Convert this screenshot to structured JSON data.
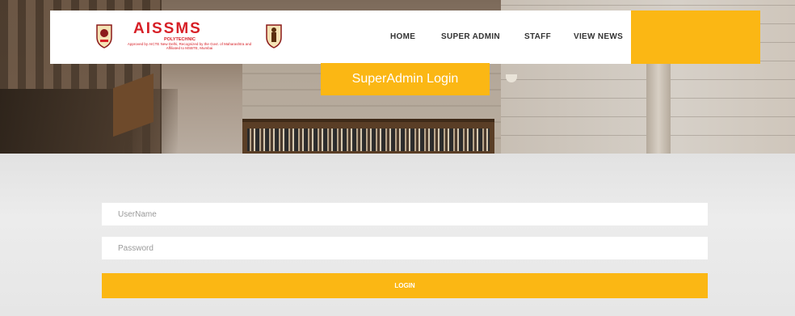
{
  "brand": {
    "name": "AISSMS",
    "subtitle": "POLYTECHNIC",
    "note": "Approved by AICTE New Delhi, Recognized by the Govt. of Maharashtra and Affiliated to MSBTE, Mumbai",
    "emblem_icon": "college-crest-icon"
  },
  "nav": {
    "items": [
      "HOME",
      "SUPER ADMIN",
      "STAFF",
      "VIEW NEWS"
    ]
  },
  "login": {
    "title": "SuperAdmin Login",
    "username_placeholder": "UserName",
    "password_placeholder": "Password",
    "username_value": "",
    "password_value": "",
    "button_label": "LOGIN"
  },
  "colors": {
    "accent": "#fbb714",
    "brand_red": "#d72027"
  }
}
